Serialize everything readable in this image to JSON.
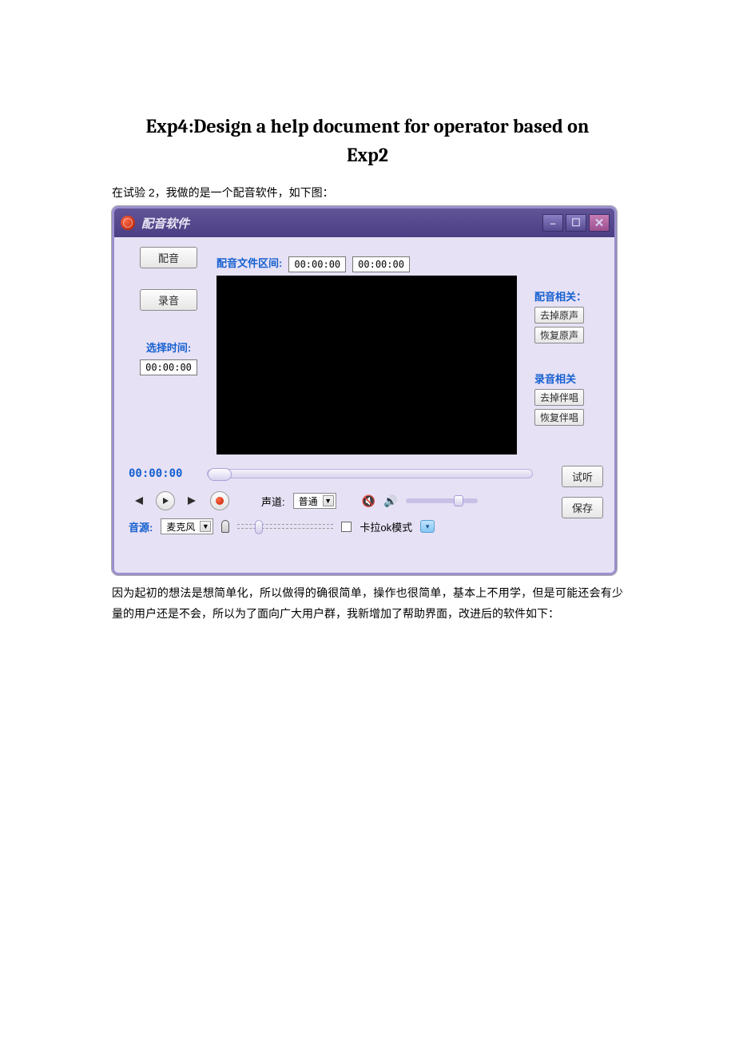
{
  "doc": {
    "title_line1": "Exp4:Design a help document for operator based on",
    "title_line2": "Exp2",
    "intro": "在试验 2，我做的是一个配音软件，如下图：",
    "para": "因为起初的想法是想简单化，所以做得的确很简单，操作也很简单，基本上不用学，但是可能还会有少量的用户还是不会，所以为了面向广大用户群，我新增加了帮助界面，改进后的软件如下："
  },
  "app": {
    "title": "配音软件",
    "dub_button": "配音",
    "record_button": "录音",
    "select_time_label": "选择时间:",
    "select_time_value": "00:00:00",
    "file_range_label": "配音文件区间:",
    "file_range_start": "00:00:00",
    "file_range_end": "00:00:00",
    "dub_group_label": "配音相关：",
    "remove_vocal": "去掉原声",
    "restore_vocal": "恢复原声",
    "rec_group_label": "录音相关",
    "remove_accomp": "去掉伴唱",
    "restore_accomp": "恢复伴唱",
    "play_time": "00:00:00",
    "preview_button": "试听",
    "save_button": "保存",
    "channel_label": "声道:",
    "channel_value": "普通",
    "source_label": "音源:",
    "source_value": "麦克风",
    "karaoke_label": "卡拉ok模式"
  }
}
